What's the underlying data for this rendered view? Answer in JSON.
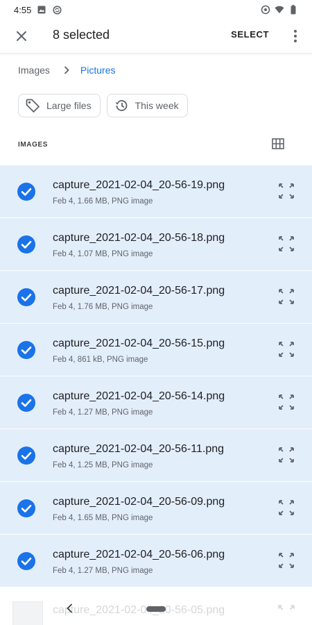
{
  "status_bar": {
    "time": "4:55"
  },
  "appbar": {
    "title": "8 selected",
    "select_label": "SELECT"
  },
  "breadcrumb": {
    "root": "Images",
    "current": "Pictures"
  },
  "chips": [
    {
      "label": "Large files",
      "icon": "tag-icon"
    },
    {
      "label": "This week",
      "icon": "history-icon"
    }
  ],
  "section": {
    "label": "IMAGES"
  },
  "files": [
    {
      "name": "capture_2021-02-04_20-56-19.png",
      "meta": "Feb 4, 1.66 MB, PNG image",
      "selected": true
    },
    {
      "name": "capture_2021-02-04_20-56-18.png",
      "meta": "Feb 4, 1.07 MB, PNG image",
      "selected": true
    },
    {
      "name": "capture_2021-02-04_20-56-17.png",
      "meta": "Feb 4, 1.76 MB, PNG image",
      "selected": true
    },
    {
      "name": "capture_2021-02-04_20-56-15.png",
      "meta": "Feb 4, 861 kB, PNG image",
      "selected": true
    },
    {
      "name": "capture_2021-02-04_20-56-14.png",
      "meta": "Feb 4, 1.27 MB, PNG image",
      "selected": true
    },
    {
      "name": "capture_2021-02-04_20-56-11.png",
      "meta": "Feb 4, 1.25 MB, PNG image",
      "selected": true
    },
    {
      "name": "capture_2021-02-04_20-56-09.png",
      "meta": "Feb 4, 1.65 MB, PNG image",
      "selected": true
    },
    {
      "name": "capture_2021-02-04_20-56-06.png",
      "meta": "Feb 4, 1.27 MB, PNG image",
      "selected": true
    }
  ],
  "partial_file": {
    "name": "capture_2021-02-04_20-56-05.png"
  },
  "colors": {
    "accent": "#1a73e8",
    "selected_bg": "#e3eefb",
    "text": "#202124",
    "secondary": "#5f6368"
  }
}
